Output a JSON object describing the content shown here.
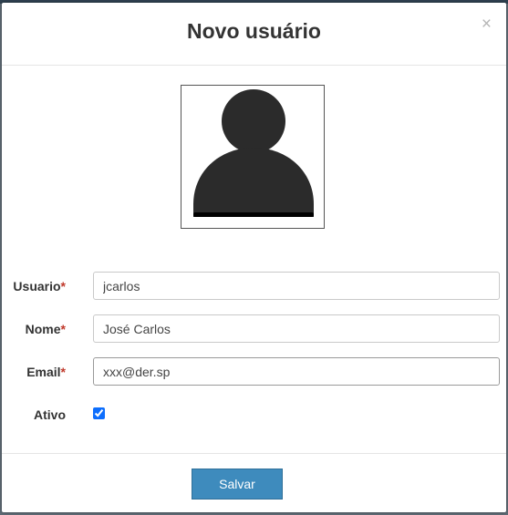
{
  "modal": {
    "title": "Novo usuário",
    "close_label": "×"
  },
  "avatar": {
    "icon": "user-silhouette-icon"
  },
  "form": {
    "required_marker": "*",
    "usuario": {
      "label": "Usuario",
      "value": "jcarlos"
    },
    "nome": {
      "label": "Nome",
      "value": "José Carlos"
    },
    "email": {
      "label": "Email",
      "value": "xxx@der.sp"
    },
    "ativo": {
      "label": "Ativo",
      "checked": true
    }
  },
  "footer": {
    "save_label": "Salvar"
  },
  "colors": {
    "primary_button": "#3e8bbd",
    "required_marker": "#c0392b",
    "checkbox": "#0d6efd"
  }
}
